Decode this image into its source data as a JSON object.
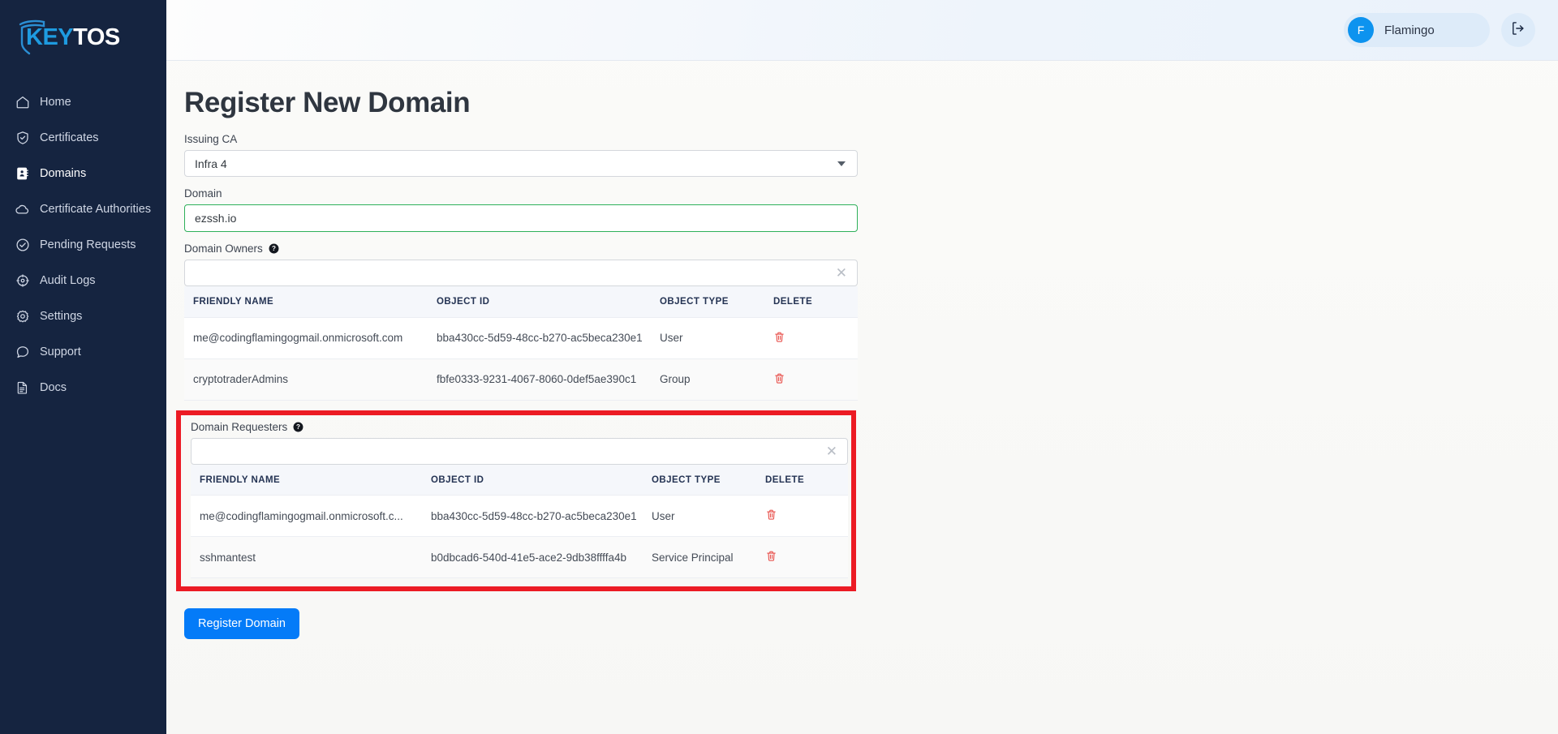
{
  "brand": {
    "logo_key": "KEY",
    "logo_tos": "TOS"
  },
  "sidebar": {
    "items": [
      {
        "label": "Home",
        "icon": "home-icon",
        "active": false
      },
      {
        "label": "Certificates",
        "icon": "shield-check-icon",
        "active": false
      },
      {
        "label": "Domains",
        "icon": "address-book-icon",
        "active": true
      },
      {
        "label": "Certificate Authorities",
        "icon": "cloud-icon",
        "active": false
      },
      {
        "label": "Pending Requests",
        "icon": "check-circle-icon",
        "active": false
      },
      {
        "label": "Audit Logs",
        "icon": "clock-icon",
        "active": false
      },
      {
        "label": "Settings",
        "icon": "gear-icon",
        "active": false
      },
      {
        "label": "Support",
        "icon": "chat-bubble-icon",
        "active": false
      },
      {
        "label": "Docs",
        "icon": "document-icon",
        "active": false
      }
    ]
  },
  "topbar": {
    "user_initial": "F",
    "user_name": "Flamingo",
    "logout_icon": "logout-icon"
  },
  "page": {
    "title": "Register New Domain"
  },
  "issuing_ca": {
    "label": "Issuing CA",
    "selected": "Infra 4"
  },
  "domain": {
    "label": "Domain",
    "value": "ezssh.io",
    "placeholder": ""
  },
  "domain_owners": {
    "label": "Domain Owners",
    "help_icon": "help-circle-icon",
    "picker_value": "",
    "picker_placeholder": "",
    "clear_icon": "close-icon",
    "columns": [
      "FRIENDLY NAME",
      "OBJECT ID",
      "OBJECT TYPE",
      "DELETE"
    ],
    "rows": [
      {
        "friendly_name": "me@codingflamingogmail.onmicrosoft.com",
        "object_id": "bba430cc-5d59-48cc-b270-ac5beca230e1",
        "object_type": "User"
      },
      {
        "friendly_name": "cryptotraderAdmins",
        "object_id": "fbfe0333-9231-4067-8060-0def5ae390c1",
        "object_type": "Group"
      }
    ]
  },
  "domain_requesters": {
    "label": "Domain Requesters",
    "help_icon": "help-circle-icon",
    "picker_value": "",
    "picker_placeholder": "",
    "clear_icon": "close-icon",
    "highlighted": true,
    "columns": [
      "FRIENDLY NAME",
      "OBJECT ID",
      "OBJECT TYPE",
      "DELETE"
    ],
    "rows": [
      {
        "friendly_name": "me@codingflamingogmail.onmicrosoft.c...",
        "object_id": "bba430cc-5d59-48cc-b270-ac5beca230e1",
        "object_type": "User"
      },
      {
        "friendly_name": "sshmantest",
        "object_id": "b0dbcad6-540d-41e5-ace2-9db38ffffa4b",
        "object_type": "Service Principal"
      }
    ]
  },
  "actions": {
    "register_label": "Register Domain"
  },
  "colors": {
    "sidebar_bg": "#152440",
    "accent_blue": "#047bf8",
    "logo_blue": "#1e9be0",
    "highlight_red": "#ec1b24",
    "valid_green": "#2eb05a",
    "delete_red": "#e8514c"
  }
}
